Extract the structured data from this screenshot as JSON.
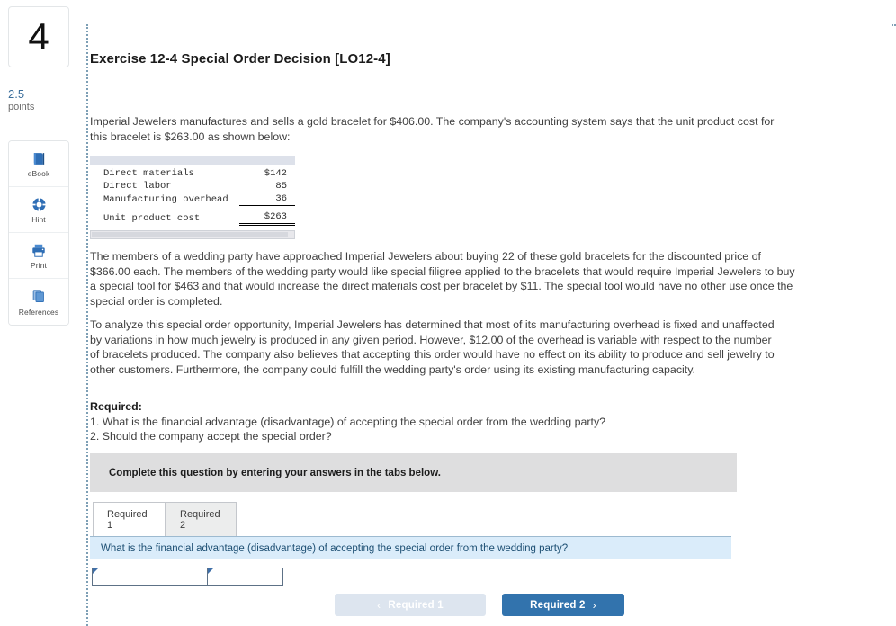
{
  "sidebar": {
    "question_number": "4",
    "points_value": "2.5",
    "points_label": "points",
    "tools": [
      {
        "icon": "book-icon",
        "label": "eBook"
      },
      {
        "icon": "lifebuoy-icon",
        "label": "Hint"
      },
      {
        "icon": "printer-icon",
        "label": "Print"
      },
      {
        "icon": "copy-pages-icon",
        "label": "References"
      }
    ]
  },
  "exercise": {
    "title": "Exercise 12-4 Special Order Decision [LO12-4]",
    "intro": "Imperial Jewelers manufactures and sells a gold bracelet for $406.00. The company's accounting system says that the unit product cost for this bracelet is $263.00 as shown below:",
    "paragraph_wedding": "The members of a wedding party have approached Imperial Jewelers about buying 22 of these gold bracelets for the discounted price of $366.00 each. The members of the wedding party would like special filigree applied to the bracelets that would require Imperial Jewelers to buy a special tool for $463 and that would increase the direct materials cost per bracelet by $11. The special tool would have no other use once the special order is completed.",
    "paragraph_analysis": "To analyze this special order opportunity, Imperial Jewelers has determined that most of its manufacturing overhead is fixed and unaffected by variations in how much jewelry is produced in any given period. However, $12.00 of the overhead is variable with respect to the number of bracelets produced. The company also believes that accepting this order would have no effect on its ability to produce and sell jewelry to other customers. Furthermore, the company could fulfill the wedding party's order using its existing manufacturing capacity.",
    "required_heading": "Required:",
    "required_items": [
      "1. What is the financial advantage (disadvantage) of accepting the special order from the wedding party?",
      "2. Should the company accept the special order?"
    ]
  },
  "cost_table": {
    "rows": [
      {
        "label": "Direct materials",
        "value": "$142"
      },
      {
        "label": "Direct labor",
        "value": "85"
      },
      {
        "label": "Manufacturing overhead",
        "value": "36"
      }
    ],
    "total": {
      "label": "Unit product cost",
      "value": "$263"
    }
  },
  "answer_panel": {
    "instruction": "Complete this question by entering your answers in the tabs below.",
    "tabs": [
      {
        "label": "Required 1",
        "active": true
      },
      {
        "label": "Required 2",
        "active": false
      }
    ],
    "question_prompt": "What is the financial advantage (disadvantage) of accepting the special order from the wedding party?",
    "answer_cells": [
      "",
      ""
    ],
    "prev_button": {
      "label": "Required 1",
      "chevron": "‹"
    },
    "next_button": {
      "label": "Required 2",
      "chevron": "›"
    }
  },
  "colors": {
    "accent_blue": "#3273ad",
    "question_bar_bg": "#daecfa",
    "instruction_bg": "#dededf",
    "table_band": "#dde1ea",
    "points_text": "#3b6e9b"
  }
}
